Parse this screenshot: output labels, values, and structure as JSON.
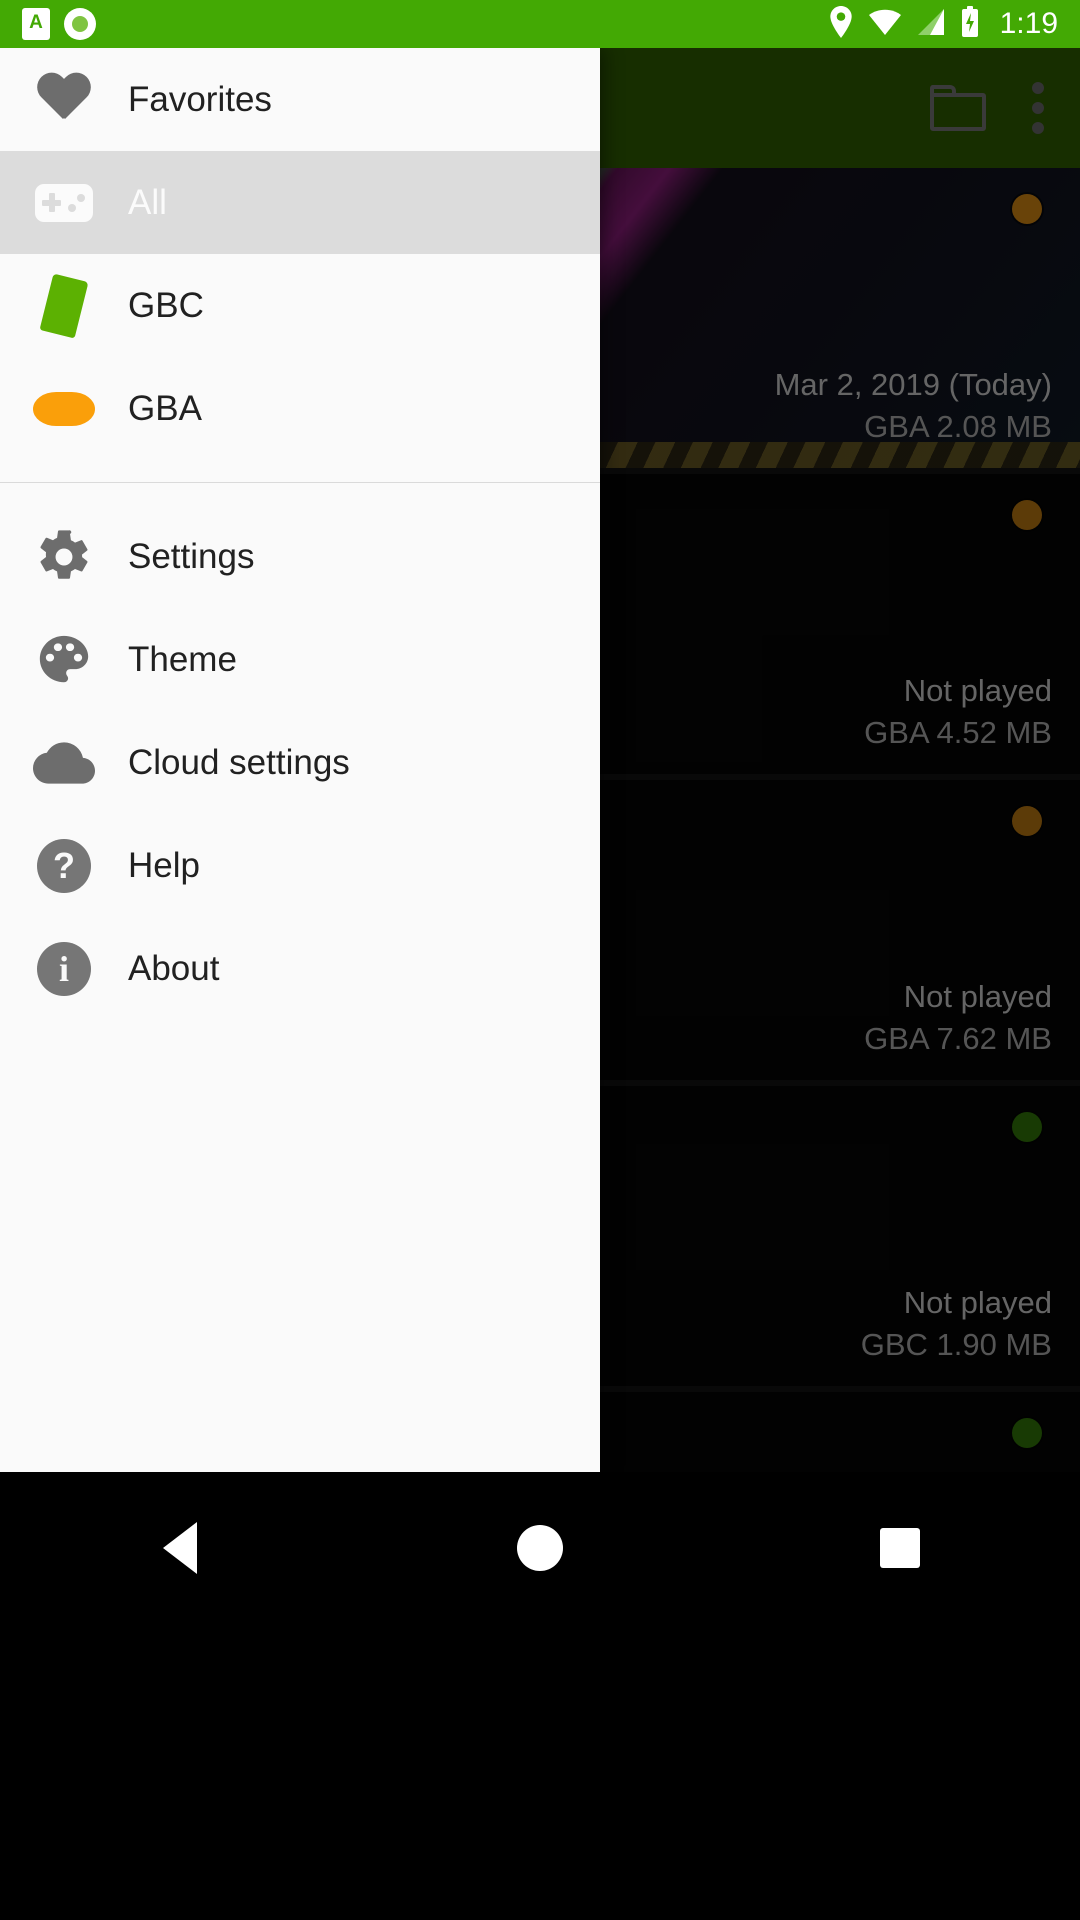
{
  "status_bar": {
    "time": "1:19",
    "background": "#43a904",
    "left_icons": [
      "app-notification-icon",
      "record-icon"
    ],
    "right_icons": [
      "location-icon",
      "wifi-icon",
      "cellular-signal-icon",
      "battery-charging-icon"
    ]
  },
  "app_bar": {
    "background": "#2b5401",
    "folder_icon": "folder-icon",
    "overflow_icon": "more-vert-icon"
  },
  "drawer": {
    "background": "#fafafa",
    "highlight_color": "#dcdcdc",
    "sections": [
      {
        "items": [
          {
            "label": "Favorites",
            "icon": "heart-icon",
            "active": false
          },
          {
            "label": "All",
            "icon": "gamepad-icon",
            "active": true
          },
          {
            "label": "GBC",
            "icon": "gbc-cartridge-icon",
            "active": false,
            "color": "#5cb102"
          },
          {
            "label": "GBA",
            "icon": "gba-console-icon",
            "active": false,
            "color": "#fa9f0a"
          }
        ]
      },
      {
        "items": [
          {
            "label": "Settings",
            "icon": "gear-icon",
            "active": false
          },
          {
            "label": "Theme",
            "icon": "palette-icon",
            "active": false
          },
          {
            "label": "Cloud settings",
            "icon": "cloud-icon",
            "active": false
          },
          {
            "label": "Help",
            "icon": "help-circle-icon",
            "active": false
          },
          {
            "label": "About",
            "icon": "info-circle-icon",
            "active": false
          }
        ]
      }
    ]
  },
  "game_list": [
    {
      "last_played": "Mar 2, 2019 (Today)",
      "system_and_size": "GBA 2.08 MB",
      "badge_color": "#c07a12",
      "has_artwork": true
    },
    {
      "last_played": "Not played",
      "system_and_size": "GBA 4.52 MB",
      "badge_color": "#a86c10",
      "has_artwork": false
    },
    {
      "last_played": "Not played",
      "system_and_size": "GBA 7.62 MB",
      "badge_color": "#a86c10",
      "has_artwork": false
    },
    {
      "last_played": "Not played",
      "system_and_size": "GBC 1.90 MB",
      "badge_color": "#2c6a08",
      "has_artwork": false
    },
    {
      "last_played": "",
      "system_and_size": "",
      "badge_color": "#2c6a08",
      "has_artwork": false
    }
  ],
  "nav_bar": {
    "back": "back-nav-icon",
    "home": "home-nav-icon",
    "recents": "recents-nav-icon"
  }
}
